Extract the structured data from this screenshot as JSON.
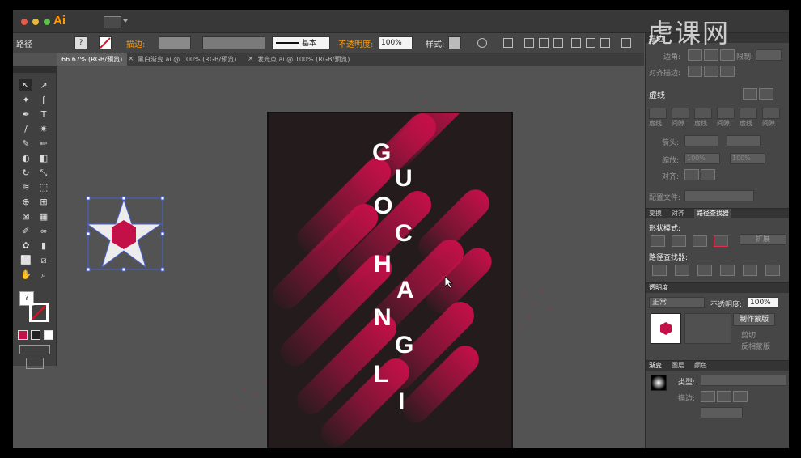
{
  "app": {
    "logo": "Ai",
    "colors": {
      "logo": "#ff9a00",
      "menubar": "#383838",
      "controlbar": "#454545",
      "workspace": "#535353",
      "artboard": "#231b1c",
      "accent": "#c41048"
    }
  },
  "control_bar": {
    "object_type": "路径",
    "stroke_label": "描边:",
    "stroke_style": "基本",
    "opacity_label": "不透明度:",
    "opacity_value": "100%",
    "style_label": "样式:"
  },
  "tabs": [
    {
      "label": "66.67% (RGB/预览)",
      "active": true
    },
    {
      "label": "黑白渐变.ai @ 100% (RGB/预览)",
      "active": false
    },
    {
      "label": "发光点.ai @ 100% (RGB/预览)",
      "active": false
    }
  ],
  "tools": [
    "selection-tool",
    "direct-selection-tool",
    "magic-wand-tool",
    "lasso-tool",
    "pen-tool",
    "type-tool",
    "line-tool",
    "flare-tool",
    "paintbrush-tool",
    "pencil-tool",
    "blob-brush-tool",
    "eraser-tool",
    "rotate-tool",
    "scale-tool",
    "width-tool",
    "free-transform-tool",
    "shape-builder-tool",
    "perspective-grid-tool",
    "mesh-tool",
    "gradient-tool",
    "eyedropper-tool",
    "blend-tool",
    "symbol-sprayer-tool",
    "column-graph-tool",
    "artboard-tool",
    "slice-tool",
    "hand-tool",
    "zoom-tool"
  ],
  "poster_letters": [
    {
      "char": "G"
    },
    {
      "char": "U"
    },
    {
      "char": "O"
    },
    {
      "char": "C"
    },
    {
      "char": "H"
    },
    {
      "char": "A"
    },
    {
      "char": "N"
    },
    {
      "char": "G"
    },
    {
      "char": "L"
    },
    {
      "char": "I"
    }
  ],
  "panel": {
    "stroke_section": {
      "title": "描边",
      "corner_label": "边角:",
      "limit_label": "限制:",
      "align_label": "对齐描边:"
    },
    "dash_section": {
      "title": "虚线",
      "dash_labels": [
        "虚线",
        "间隙",
        "虚线",
        "间隙",
        "虚线",
        "间隙"
      ],
      "arrow_label": "箭头:",
      "scale_label": "缩放:",
      "scale_values": [
        "100%",
        "100%"
      ],
      "align_label": "对齐:",
      "profile_label": "配置文件:"
    },
    "pathfinder_tabs": [
      "变换",
      "对齐",
      "路径查找器"
    ],
    "shape_modes_label": "形状模式:",
    "expand_label": "扩展",
    "pathfinders_label": "路径查找器:",
    "transparency": {
      "title": "透明度",
      "blend_mode": "正常",
      "opacity_label": "不透明度:",
      "opacity_value": "100%",
      "make_mask_label": "制作蒙版",
      "clip_label": "剪切",
      "invert_label": "反相蒙版"
    },
    "bottom_tabs": [
      "渐变",
      "图层",
      "颜色"
    ],
    "gradient": {
      "type_label": "类型:",
      "stroke_label": "描边:"
    }
  },
  "watermark": "虎课网"
}
